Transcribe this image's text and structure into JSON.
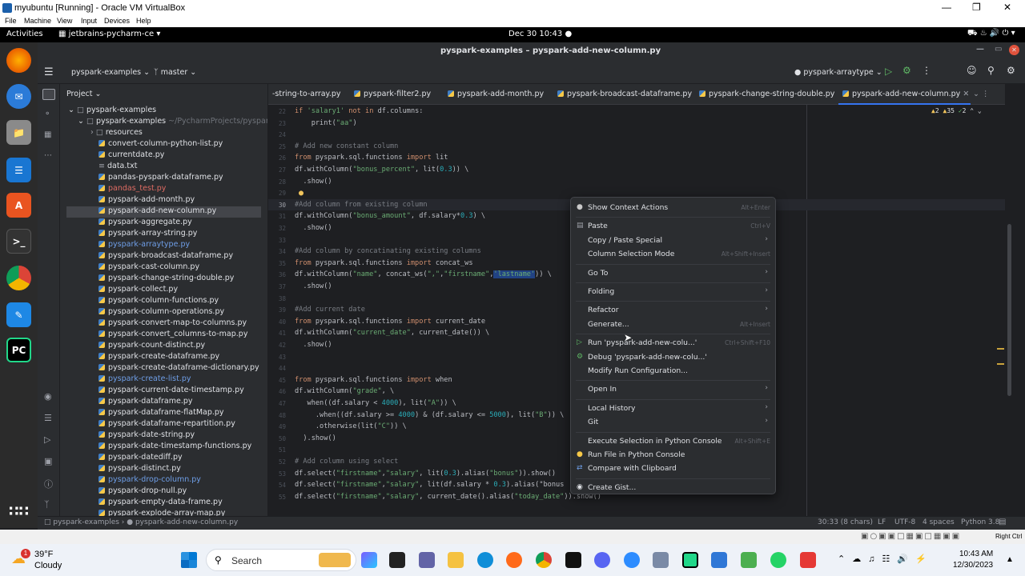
{
  "vbox": {
    "title": "myubuntu [Running] - Oracle VM VirtualBox",
    "menu": [
      "File",
      "Machine",
      "View",
      "Input",
      "Devices",
      "Help"
    ]
  },
  "gnome": {
    "activities": "Activities",
    "app": "jetbrains-pycharm-ce",
    "clock": "Dec 30  10:43"
  },
  "window_title": "pyspark-examples – pyspark-add-new-column.py",
  "toolbar": {
    "project": "pyspark-examples",
    "branch": "master",
    "run_config": "pyspark-arraytype"
  },
  "project_panel": {
    "title": "Project",
    "root": "pyspark-examples",
    "sub": "pyspark-examples",
    "sub_path": "~/PycharmProjects/pyspark-ex",
    "items": [
      {
        "name": "resources",
        "kind": "folder"
      },
      {
        "name": "convert-column-python-list.py",
        "kind": "py"
      },
      {
        "name": "currentdate.py",
        "kind": "py"
      },
      {
        "name": "data.txt",
        "kind": "txt"
      },
      {
        "name": "pandas-pyspark-dataframe.py",
        "kind": "py"
      },
      {
        "name": "pandas_test.py",
        "kind": "err"
      },
      {
        "name": "pyspark-add-month.py",
        "kind": "py"
      },
      {
        "name": "pyspark-add-new-column.py",
        "kind": "sel"
      },
      {
        "name": "pyspark-aggregate.py",
        "kind": "py"
      },
      {
        "name": "pyspark-array-string.py",
        "kind": "py"
      },
      {
        "name": "pyspark-arraytype.py",
        "kind": "mod"
      },
      {
        "name": "pyspark-broadcast-dataframe.py",
        "kind": "py"
      },
      {
        "name": "pyspark-cast-column.py",
        "kind": "py"
      },
      {
        "name": "pyspark-change-string-double.py",
        "kind": "py"
      },
      {
        "name": "pyspark-collect.py",
        "kind": "py"
      },
      {
        "name": "pyspark-column-functions.py",
        "kind": "py"
      },
      {
        "name": "pyspark-column-operations.py",
        "kind": "py"
      },
      {
        "name": "pyspark-convert-map-to-columns.py",
        "kind": "py"
      },
      {
        "name": "pyspark-convert_columns-to-map.py",
        "kind": "py"
      },
      {
        "name": "pyspark-count-distinct.py",
        "kind": "py"
      },
      {
        "name": "pyspark-create-dataframe.py",
        "kind": "py"
      },
      {
        "name": "pyspark-create-dataframe-dictionary.py",
        "kind": "py"
      },
      {
        "name": "pyspark-create-list.py",
        "kind": "mod"
      },
      {
        "name": "pyspark-current-date-timestamp.py",
        "kind": "py"
      },
      {
        "name": "pyspark-dataframe.py",
        "kind": "py"
      },
      {
        "name": "pyspark-dataframe-flatMap.py",
        "kind": "py"
      },
      {
        "name": "pyspark-dataframe-repartition.py",
        "kind": "py"
      },
      {
        "name": "pyspark-date-string.py",
        "kind": "py"
      },
      {
        "name": "pyspark-date-timestamp-functions.py",
        "kind": "py"
      },
      {
        "name": "pyspark-datediff.py",
        "kind": "py"
      },
      {
        "name": "pyspark-distinct.py",
        "kind": "py"
      },
      {
        "name": "pyspark-drop-column.py",
        "kind": "mod"
      },
      {
        "name": "pyspark-drop-null.py",
        "kind": "py"
      },
      {
        "name": "pyspark-empty-data-frame.py",
        "kind": "py"
      },
      {
        "name": "pyspark-explode-array-map.py",
        "kind": "py"
      }
    ]
  },
  "tabs": [
    {
      "label": "-string-to-array.py"
    },
    {
      "label": "pyspark-filter2.py"
    },
    {
      "label": "pyspark-add-month.py"
    },
    {
      "label": "pyspark-broadcast-dataframe.py"
    },
    {
      "label": "pyspark-change-string-double.py"
    },
    {
      "label": "pyspark-add-new-column.py",
      "active": true
    }
  ],
  "inspections": {
    "warnings": "2",
    "weak": "35",
    "typos": "2"
  },
  "code": [
    {
      "n": "22",
      "t": "if 'salary1' not in df.columns:"
    },
    {
      "n": "23",
      "t": "    print(\"aa\")"
    },
    {
      "n": "24",
      "t": ""
    },
    {
      "n": "25",
      "t": "# Add new constant column"
    },
    {
      "n": "26",
      "t": "from pyspark.sql.functions import lit"
    },
    {
      "n": "27",
      "t": "df.withColumn(\"bonus_percent\", lit(0.3)) \\"
    },
    {
      "n": "28",
      "t": "  .show()"
    },
    {
      "n": "29",
      "t": ""
    },
    {
      "n": "30",
      "t": "#Add column from existing column"
    },
    {
      "n": "31",
      "t": "df.withColumn(\"bonus_amount\", df.salary*0.3) \\"
    },
    {
      "n": "32",
      "t": "  .show()"
    },
    {
      "n": "33",
      "t": ""
    },
    {
      "n": "34",
      "t": "#Add column by concatinating existing columns"
    },
    {
      "n": "35",
      "t": "from pyspark.sql.functions import concat_ws"
    },
    {
      "n": "36",
      "t": "df.withColumn(\"name\", concat_ws(\",\",\"firstname\",'lastname')) \\"
    },
    {
      "n": "37",
      "t": "  .show()"
    },
    {
      "n": "38",
      "t": ""
    },
    {
      "n": "39",
      "t": "#Add current date"
    },
    {
      "n": "40",
      "t": "from pyspark.sql.functions import current_date"
    },
    {
      "n": "41",
      "t": "df.withColumn(\"current_date\", current_date()) \\"
    },
    {
      "n": "42",
      "t": "  .show()"
    },
    {
      "n": "43",
      "t": ""
    },
    {
      "n": "44",
      "t": ""
    },
    {
      "n": "45",
      "t": "from pyspark.sql.functions import when"
    },
    {
      "n": "46",
      "t": "df.withColumn(\"grade\", \\"
    },
    {
      "n": "47",
      "t": "   when((df.salary < 4000), lit(\"A\")) \\"
    },
    {
      "n": "48",
      "t": "     .when((df.salary >= 4000) & (df.salary <= 5000), lit(\"B\")) \\"
    },
    {
      "n": "49",
      "t": "     .otherwise(lit(\"C\")) \\"
    },
    {
      "n": "50",
      "t": "  ).show()"
    },
    {
      "n": "51",
      "t": ""
    },
    {
      "n": "52",
      "t": "# Add column using select"
    },
    {
      "n": "53",
      "t": "df.select(\"firstname\",\"salary\", lit(0.3).alias(\"bonus\")).show()"
    },
    {
      "n": "54",
      "t": "df.select(\"firstname\",\"salary\", lit(df.salary * 0.3).alias(\"bonus"
    },
    {
      "n": "55",
      "t": "df.select(\"firstname\",\"salary\", current_date().alias(\"today_date\")).show()"
    }
  ],
  "context_menu": [
    {
      "label": "Show Context Actions",
      "shortcut": "Alt+Enter",
      "icon": "bulb-icon"
    },
    {
      "sep": true
    },
    {
      "label": "Paste",
      "shortcut": "Ctrl+V",
      "icon": "paste-icon"
    },
    {
      "label": "Copy / Paste Special",
      "submenu": true
    },
    {
      "label": "Column Selection Mode",
      "shortcut": "Alt+Shift+Insert"
    },
    {
      "sep": true
    },
    {
      "label": "Go To",
      "submenu": true
    },
    {
      "sep": true
    },
    {
      "label": "Folding",
      "submenu": true
    },
    {
      "sep": true
    },
    {
      "label": "Refactor",
      "submenu": true
    },
    {
      "label": "Generate...",
      "shortcut": "Alt+Insert"
    },
    {
      "sep": true
    },
    {
      "label": "Run 'pyspark-add-new-colu...'",
      "shortcut": "Ctrl+Shift+F10",
      "icon": "run-icon"
    },
    {
      "label": "Debug 'pyspark-add-new-colu...'",
      "icon": "debug-icon"
    },
    {
      "label": "Modify Run Configuration..."
    },
    {
      "sep": true
    },
    {
      "label": "Open In",
      "submenu": true
    },
    {
      "sep": true
    },
    {
      "label": "Local History",
      "submenu": true
    },
    {
      "label": "Git",
      "submenu": true
    },
    {
      "sep": true
    },
    {
      "label": "Execute Selection in Python Console",
      "shortcut": "Alt+Shift+E"
    },
    {
      "label": "Run File in Python Console",
      "icon": "python-icon"
    },
    {
      "label": "Compare with Clipboard",
      "icon": "compare-icon"
    },
    {
      "sep": true
    },
    {
      "label": "Create Gist...",
      "icon": "github-icon"
    }
  ],
  "statusbar": {
    "crumb_project": "pyspark-examples",
    "crumb_file": "pyspark-add-new-column.py",
    "position": "30:33 (8 chars)",
    "line_sep": "LF",
    "encoding": "UTF-8",
    "indent": "4 spaces",
    "interpreter": "Python 3.8"
  },
  "vb_status": {
    "host_key": "Right Ctrl"
  },
  "taskbar": {
    "weather_temp": "39°F",
    "weather_desc": "Cloudy",
    "weather_badge": "1",
    "search": "Search",
    "time": "10:43 AM",
    "date": "12/30/2023"
  },
  "colors": {
    "accent": "#3574f0",
    "keyword": "#cf8e6d",
    "string": "#6aab73",
    "comment": "#7a7e85",
    "number": "#2aacb8"
  }
}
